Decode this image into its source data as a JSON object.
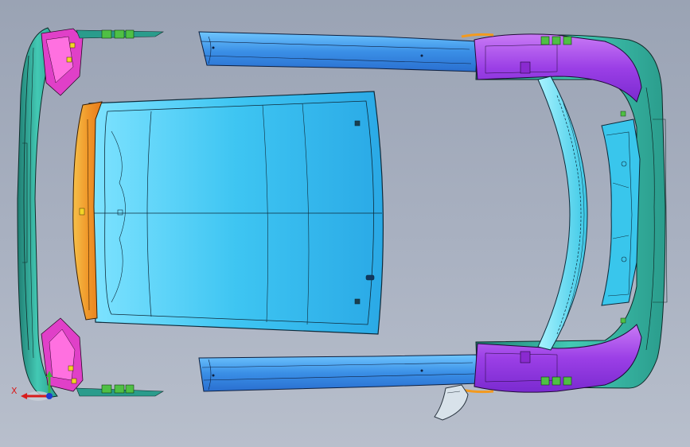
{
  "viewport": {
    "background_top": "#9aa3b4",
    "background_bottom": "#b8bfcc"
  },
  "colors": {
    "cyan": "#39c6ec",
    "blue": "#2f8fe0",
    "teal": "#2a9c8c",
    "purple": "#a24ae8",
    "magenta": "#e040c8",
    "orange": "#f39a1f",
    "green": "#3fb540",
    "outline": "#102030"
  },
  "parts": [
    "front-bumper-assembly",
    "roof-panel",
    "left-side-sill",
    "right-side-sill",
    "rear-bumper-assembly",
    "rear-window-frame",
    "tailgate-inner-panel",
    "door-handle-part"
  ],
  "triad": {
    "axis_label": "X",
    "icon": "coordinate-triad-icon"
  }
}
